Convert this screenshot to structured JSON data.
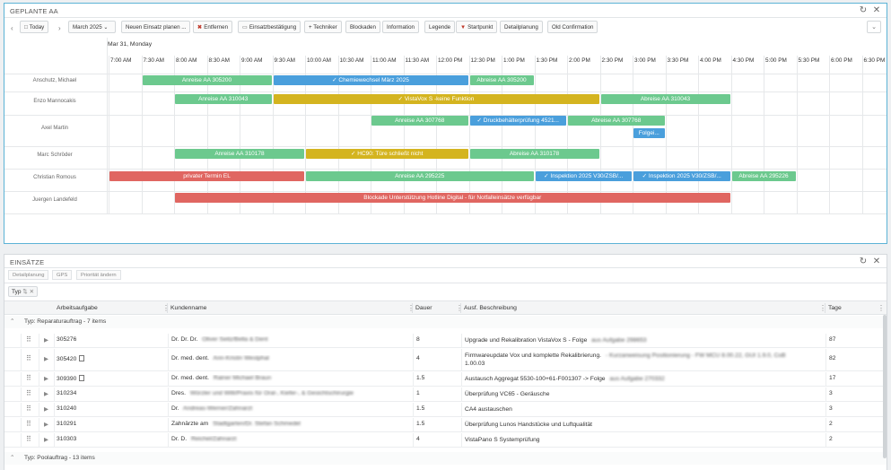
{
  "planner": {
    "title": "GEPLANTE AA",
    "today_label": "Today",
    "month_label": "March 2025",
    "toolbar": [
      "Neuen Einsatz planen ...",
      "Entfernen",
      "Einsatzbestätigung",
      "+ Techniker",
      "Blockaden",
      "Information",
      "Legende",
      "Startpunkt",
      "Detailplanung",
      "Old Confirmation"
    ],
    "date_header": "Mar 31, Monday",
    "times": [
      "7:00 AM",
      "7:30 AM",
      "8:00 AM",
      "8:30 AM",
      "9:00 AM",
      "9:30 AM",
      "10:00 AM",
      "10:30 AM",
      "11:00 AM",
      "11:30 AM",
      "12:00 PM",
      "12:30 PM",
      "1:00 PM",
      "1:30 PM",
      "2:00 PM",
      "2:30 PM",
      "3:00 PM",
      "3:30 PM",
      "4:00 PM",
      "4:30 PM",
      "5:00 PM",
      "5:30 PM",
      "6:00 PM",
      "6:30 PM"
    ],
    "resources": [
      "Anschutz, Michael",
      "Enzo Mannocakis",
      "Axel Martin",
      "Marc Schröder",
      "Christian Romous",
      "Juergen Landefeld"
    ],
    "events": [
      {
        "label": "Anreise AA 305200",
        "color": "green",
        "row": 0,
        "lane": 0,
        "start": "7:30 AM",
        "end": "9:30 AM",
        "check": false
      },
      {
        "label": "Chemiewechsel März 2025",
        "color": "blue",
        "row": 0,
        "lane": 0,
        "start": "9:30 AM",
        "end": "12:30 PM",
        "check": true
      },
      {
        "label": "Abreise AA 305200",
        "color": "green",
        "row": 0,
        "lane": 0,
        "start": "12:30 PM",
        "end": "1:30 PM",
        "check": false
      },
      {
        "label": "Anreise AA 310043",
        "color": "green",
        "row": 1,
        "lane": 0,
        "start": "8:00 AM",
        "end": "9:30 AM",
        "check": false
      },
      {
        "label": "VistaVox S -keine Funktion",
        "color": "yellow",
        "row": 1,
        "lane": 0,
        "start": "9:30 AM",
        "end": "2:30 PM",
        "check": true
      },
      {
        "label": "Abreise AA 310043",
        "color": "green",
        "row": 1,
        "lane": 0,
        "start": "2:30 PM",
        "end": "4:30 PM",
        "check": false
      },
      {
        "label": "Anreise AA 307768",
        "color": "green",
        "row": 2,
        "lane": 0,
        "start": "11:00 AM",
        "end": "12:30 PM",
        "check": false
      },
      {
        "label": "Druckbehälterprüfung 4521...",
        "color": "blue",
        "row": 2,
        "lane": 0,
        "start": "12:30 PM",
        "end": "2:00 PM",
        "check": true
      },
      {
        "label": "Abreise AA 307768",
        "color": "green",
        "row": 2,
        "lane": 0,
        "start": "2:00 PM",
        "end": "3:30 PM",
        "check": false
      },
      {
        "label": "Folgei...",
        "color": "blue",
        "row": 2,
        "lane": 1,
        "start": "3:00 PM",
        "end": "3:30 PM",
        "check": false
      },
      {
        "label": "Anreise AA 310178",
        "color": "green",
        "row": 3,
        "lane": 0,
        "start": "8:00 AM",
        "end": "10:00 AM",
        "check": false
      },
      {
        "label": "HC90: Türe schließt nicht",
        "color": "yellow",
        "row": 3,
        "lane": 0,
        "start": "10:00 AM",
        "end": "12:30 PM",
        "check": true
      },
      {
        "label": "Abreise AA 310178",
        "color": "green",
        "row": 3,
        "lane": 0,
        "start": "12:30 PM",
        "end": "2:30 PM",
        "check": false
      },
      {
        "label": "privater Termin EL",
        "color": "red",
        "row": 4,
        "lane": 0,
        "start": "7:00 AM",
        "end": "10:00 AM",
        "check": false
      },
      {
        "label": "Anreise AA 295225",
        "color": "green",
        "row": 4,
        "lane": 0,
        "start": "10:00 AM",
        "end": "1:30 PM",
        "check": false
      },
      {
        "label": "Inspektion 2025 V30/ZSB/...",
        "color": "blue",
        "row": 4,
        "lane": 0,
        "start": "1:30 PM",
        "end": "3:00 PM",
        "check": true
      },
      {
        "label": "Inspektion 2025 V30/ZSB/...",
        "color": "blue",
        "row": 4,
        "lane": 0,
        "start": "3:00 PM",
        "end": "4:30 PM",
        "check": true
      },
      {
        "label": "Abreise AA 295226",
        "color": "green",
        "row": 4,
        "lane": 0,
        "start": "4:30 PM",
        "end": "5:30 PM",
        "check": false
      },
      {
        "label": "Blockade Unterstützung Hotline Digital - für Notfalleinsätze verfügbar",
        "color": "red",
        "row": 5,
        "lane": 0,
        "start": "8:00 AM",
        "end": "4:30 PM",
        "check": false
      }
    ]
  },
  "einsaetze": {
    "title": "EINSÄTZE",
    "subtoolbar": [
      "Detailplanung",
      "GPS",
      "Priorität ändern"
    ],
    "group_chip": "Typ",
    "columns": [
      "Arbeitsaufgabe",
      "Kundenname",
      "Dauer",
      "Ausf. Beschreibung",
      "Tage"
    ],
    "groups": [
      {
        "label": "Typ: Reparaturauftrag - 7 items",
        "rows": [
          {
            "id": "305276",
            "doc": false,
            "kunde": "Dr. Dr. Dr.",
            "kunde_hidden": "Oliver Seitz/Bella & Dent",
            "dauer": "8",
            "beschr": "Upgrade und Rekalibration VistaVox S - Folge",
            "beschr_hidden": "aus Aufgabe 298653",
            "beschr2": "",
            "tage": "87"
          },
          {
            "id": "305420",
            "doc": true,
            "kunde": "Dr. med. dent.",
            "kunde_hidden": "Ann-Kristin Westphal",
            "dauer": "4",
            "beschr": "Firmwareupdate Vox und komplette Rekalibrierung.",
            "beschr_hidden": "- Kurzanweisung Positionierung - FW MCU 8.00.22, GUI 1.9.0, CoB",
            "beschr2": "1.00.03",
            "tage": "82"
          },
          {
            "id": "309390",
            "doc": true,
            "kunde": "Dr. med. dent.",
            "kunde_hidden": "Rainer Michael Braun",
            "dauer": "1.5",
            "beschr": "Austausch Aggregat 5530-100+61-F001307 -> Folge",
            "beschr_hidden": "aus Aufgabe 270332",
            "beschr2": "",
            "tage": "17"
          },
          {
            "id": "310234",
            "doc": false,
            "kunde": "Dres.",
            "kunde_hidden": "Würzler und Willi/Praxis für Oral-, Kiefer-, & Gesichtschirurgie",
            "dauer": "1",
            "beschr": "Überprüfung VC65 - Geräusche",
            "beschr_hidden": "",
            "beschr2": "",
            "tage": "3"
          },
          {
            "id": "310240",
            "doc": false,
            "kunde": "Dr.",
            "kunde_hidden": "Andreas-Werner/Zahnarzt",
            "dauer": "1.5",
            "beschr": "CA4 austauschen",
            "beschr_hidden": "",
            "beschr2": "",
            "tage": "3"
          },
          {
            "id": "310291",
            "doc": false,
            "kunde": "Zahnärzte am",
            "kunde_hidden": "Stadtgarten/Dr. Stefan Schmedel",
            "dauer": "1.5",
            "beschr": "Überprüfung Lunos Handstücke und Luftqualität",
            "beschr_hidden": "",
            "beschr2": "",
            "tage": "2"
          },
          {
            "id": "310303",
            "doc": false,
            "kunde": "Dr. D.",
            "kunde_hidden": "Reichel/Zahnarzt",
            "dauer": "4",
            "beschr": "VistaPano S Systemprüfung",
            "beschr_hidden": "",
            "beschr2": "",
            "tage": "2"
          }
        ]
      },
      {
        "label": "Typ: Poolauftrag - 13 items",
        "rows": []
      }
    ]
  },
  "colors": {
    "green": "#6cc98e",
    "blue": "#4a9fdc",
    "yellow": "#d4b41f",
    "red": "#e06661",
    "accent": "#5cb3d6"
  }
}
